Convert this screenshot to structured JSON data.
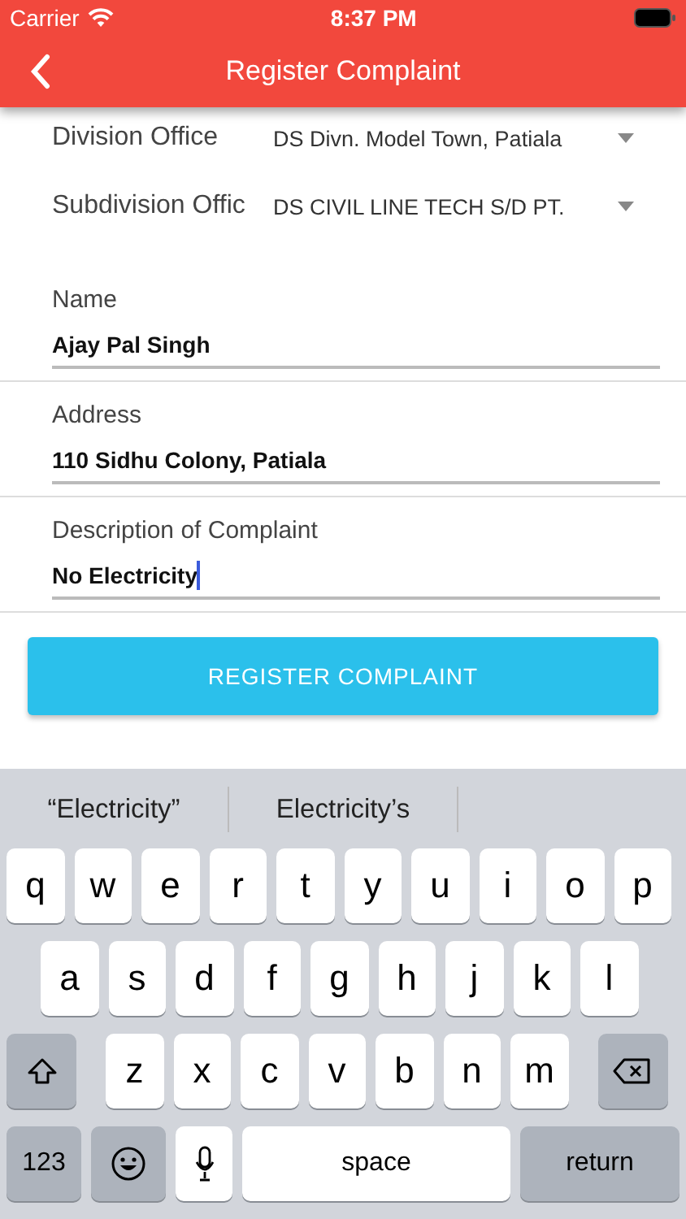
{
  "status_bar": {
    "carrier": "Carrier",
    "time": "8:37 PM"
  },
  "header": {
    "title": "Register Complaint"
  },
  "dropdowns": [
    {
      "label": "Division Office",
      "value": "DS Divn. Model Town, Patiala"
    },
    {
      "label": "Subdivision Offic",
      "value": "DS CIVIL LINE TECH S/D PT."
    }
  ],
  "fields": [
    {
      "label": "Name",
      "value": "Ajay Pal Singh",
      "focused": false
    },
    {
      "label": "Address",
      "value": "110 Sidhu Colony, Patiala",
      "focused": false
    },
    {
      "label": "Description of Complaint",
      "value": "No Electricity",
      "focused": true
    }
  ],
  "submit": "REGISTER COMPLAINT",
  "keyboard": {
    "suggestions": [
      "“Electricity”",
      "Electricity’s"
    ],
    "rows": [
      {
        "keys": [
          {
            "kind": "letter",
            "label": "q"
          },
          {
            "kind": "letter",
            "label": "w"
          },
          {
            "kind": "letter",
            "label": "e"
          },
          {
            "kind": "letter",
            "label": "r"
          },
          {
            "kind": "letter",
            "label": "t"
          },
          {
            "kind": "letter",
            "label": "y"
          },
          {
            "kind": "letter",
            "label": "u"
          },
          {
            "kind": "letter",
            "label": "i"
          },
          {
            "kind": "letter",
            "label": "o"
          },
          {
            "kind": "letter",
            "label": "p"
          }
        ]
      },
      {
        "keys": [
          {
            "kind": "letter",
            "label": "a"
          },
          {
            "kind": "letter",
            "label": "s"
          },
          {
            "kind": "letter",
            "label": "d"
          },
          {
            "kind": "letter",
            "label": "f"
          },
          {
            "kind": "letter",
            "label": "g"
          },
          {
            "kind": "letter",
            "label": "h"
          },
          {
            "kind": "letter",
            "label": "j"
          },
          {
            "kind": "letter",
            "label": "k"
          },
          {
            "kind": "letter",
            "label": "l"
          }
        ]
      },
      {
        "keys": [
          {
            "kind": "shift"
          },
          {
            "kind": "letter",
            "label": "z"
          },
          {
            "kind": "letter",
            "label": "x"
          },
          {
            "kind": "letter",
            "label": "c"
          },
          {
            "kind": "letter",
            "label": "v"
          },
          {
            "kind": "letter",
            "label": "b"
          },
          {
            "kind": "letter",
            "label": "n"
          },
          {
            "kind": "letter",
            "label": "m"
          },
          {
            "kind": "delete"
          }
        ]
      },
      {
        "keys": [
          {
            "kind": "numbers",
            "label": "123"
          },
          {
            "kind": "emoji"
          },
          {
            "kind": "mic"
          },
          {
            "kind": "space",
            "label": "space"
          },
          {
            "kind": "return",
            "label": "return"
          }
        ]
      }
    ]
  }
}
